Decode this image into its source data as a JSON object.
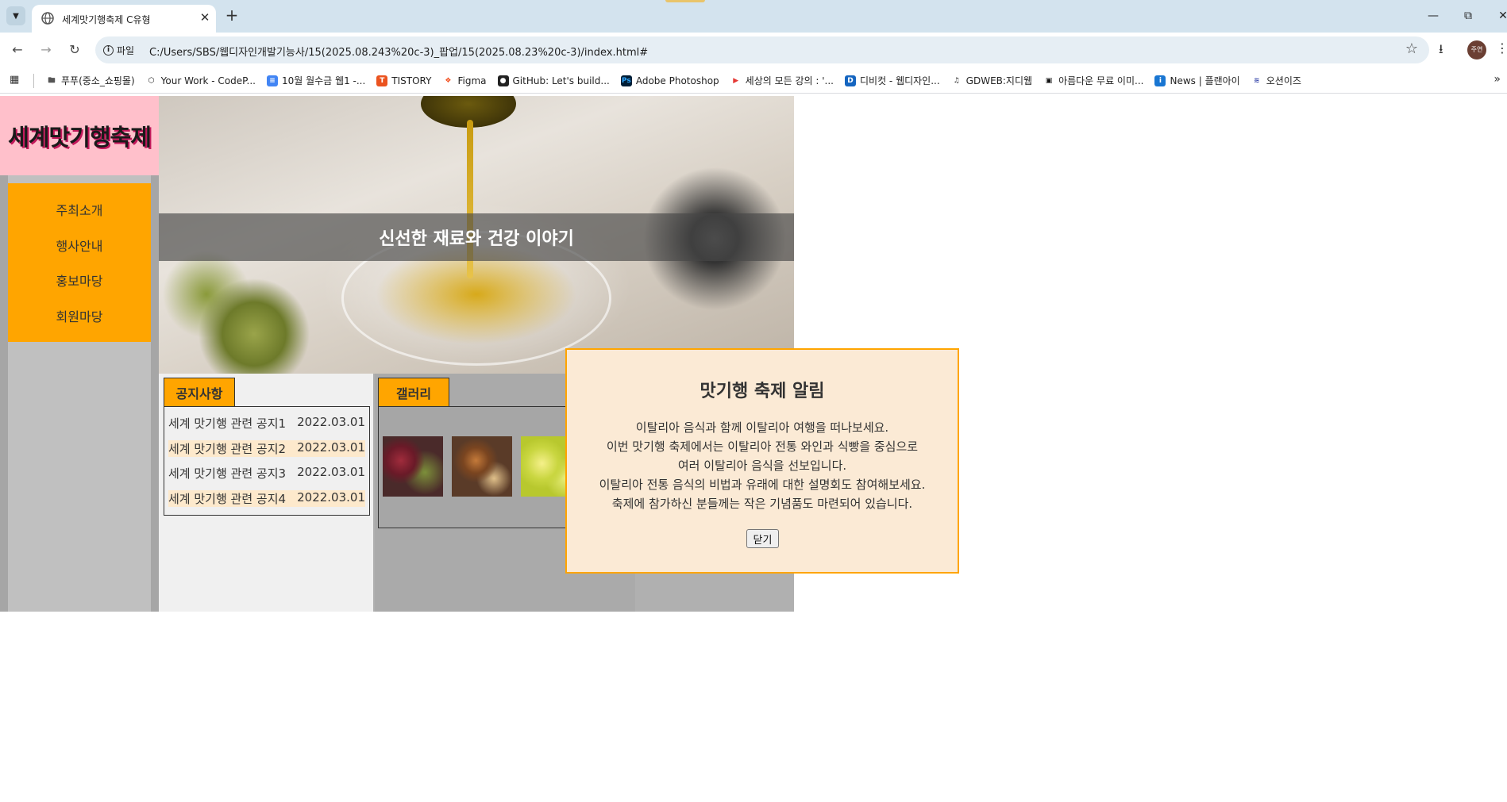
{
  "browser": {
    "tab_title": "세계맛기행축제 C유형",
    "address_scheme_label": "파일",
    "url": "C:/Users/SBS/웹디자인개발기능사/15(2025.08.243%20c-3)_팝업/15(2025.08.23%20c-3)/index.html#",
    "profile_initials": "주연",
    "bookmarks": [
      {
        "label": "푸푸(중소_쇼핑몰)",
        "icon": "folder-icon"
      },
      {
        "label": "Your Work - CodeP...",
        "icon": "codepen-icon"
      },
      {
        "label": "10월 월수금 웹1 -...",
        "icon": "docs-icon"
      },
      {
        "label": "TISTORY",
        "icon": "tistory-icon"
      },
      {
        "label": "Figma",
        "icon": "figma-icon"
      },
      {
        "label": "GitHub: Let's build...",
        "icon": "github-icon"
      },
      {
        "label": "Adobe Photoshop",
        "icon": "photoshop-icon"
      },
      {
        "label": "세상의 모든 강의 : '...",
        "icon": "play-icon"
      },
      {
        "label": "디비컷 - 웹디자인...",
        "icon": "d-icon"
      },
      {
        "label": "GDWEB:지디웹",
        "icon": "gdweb-icon"
      },
      {
        "label": "아름다운 무료 이미...",
        "icon": "unsplash-icon"
      },
      {
        "label": "News | 플랜아이",
        "icon": "info-icon"
      },
      {
        "label": "오션이즈",
        "icon": "oceanis-icon"
      }
    ]
  },
  "site": {
    "logo": "세계맛기행축제",
    "menu": [
      "주최소개",
      "행사안내",
      "홍보마당",
      "회원마당"
    ],
    "hero_caption": "신선한 재료와 건강 이야기",
    "notice": {
      "tab": "공지사항",
      "items": [
        {
          "title": "세계 맛기행 관련 공지1",
          "date": "2022.03.01"
        },
        {
          "title": "세계 맛기행 관련 공지2",
          "date": "2022.03.01"
        },
        {
          "title": "세계 맛기행 관련 공지3",
          "date": "2022.03.01"
        },
        {
          "title": "세계 맛기행 관련 공지4",
          "date": "2022.03.01"
        }
      ]
    },
    "gallery": {
      "tab": "갤러리",
      "thumbnails": [
        "grapes-figs-photo",
        "cinnamon-spices-photo",
        "lime-slices-photo"
      ]
    }
  },
  "popup": {
    "title": "맛기행 축제 알림",
    "lines": [
      "이탈리아 음식과 함께 이탈리아 여행을 떠나보세요.",
      "이번 맛기행 축제에서는 이탈리아 전통 와인과 식빵을 중심으로",
      "여러 이탈리아 음식을 선보입니다.",
      "이탈리아 전통 음식의 비법과 유래에 대한 설명회도 참여해보세요.",
      "축제에 참가하신 분들께는 작은 기념품도 마련되어 있습니다."
    ],
    "close_label": "닫기"
  },
  "colors": {
    "accent": "#ffa500",
    "logo_bg": "#ffc0cb",
    "popup_bg": "#fbead5"
  }
}
